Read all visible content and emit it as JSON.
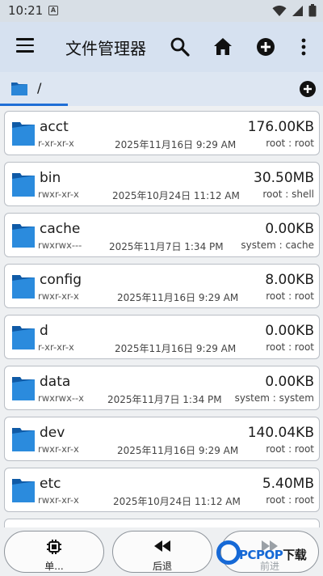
{
  "status_bar": {
    "time": "10:21",
    "notification_glyph": "A"
  },
  "app_bar": {
    "title": "文件管理器",
    "icons": [
      "menu-icon",
      "search-icon",
      "home-icon",
      "add-circle-icon",
      "more-vert-icon"
    ]
  },
  "path": {
    "current": "/"
  },
  "files": [
    {
      "name": "acct",
      "perm": "r-xr-xr-x",
      "date": "2025年11月16日 9:29 AM",
      "size": "176.00KB",
      "owner": "root : root"
    },
    {
      "name": "bin",
      "perm": "rwxr-xr-x",
      "date": "2025年10月24日 11:12 AM",
      "size": "30.50MB",
      "owner": "root : shell"
    },
    {
      "name": "cache",
      "perm": "rwxrwx---",
      "date": "2025年11月7日 1:34 PM",
      "size": "0.00KB",
      "owner": "system : cache"
    },
    {
      "name": "config",
      "perm": "rwxr-xr-x",
      "date": "2025年11月16日 9:29 AM",
      "size": "8.00KB",
      "owner": "root : root"
    },
    {
      "name": "d",
      "perm": "r-xr-xr-x",
      "date": "2025年11月16日 9:29 AM",
      "size": "0.00KB",
      "owner": "root : root"
    },
    {
      "name": "data",
      "perm": "rwxrwx--x",
      "date": "2025年11月7日 1:34 PM",
      "size": "0.00KB",
      "owner": "system : system"
    },
    {
      "name": "dev",
      "perm": "rwxr-xr-x",
      "date": "2025年11月16日 9:29 AM",
      "size": "140.04KB",
      "owner": "root : root"
    },
    {
      "name": "etc",
      "perm": "rwxr-xr-x",
      "date": "2025年10月24日 11:12 AM",
      "size": "5.40MB",
      "owner": "root : root"
    }
  ],
  "bottom_bar": {
    "select_label": "单...",
    "back_label": "后退",
    "forward_label": "前进"
  },
  "watermark": {
    "brand": "PCPOP",
    "suffix": "下载"
  },
  "colors": {
    "accent": "#1f6fd6",
    "folder": "#1a72c7",
    "app_bar": "#d6e1f0"
  }
}
